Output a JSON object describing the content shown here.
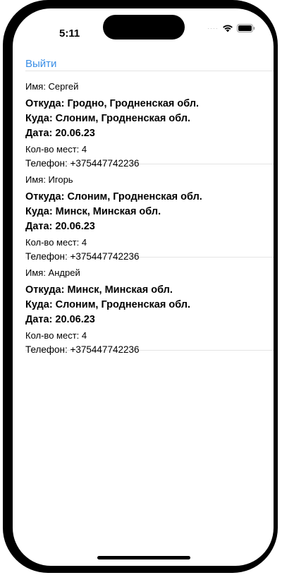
{
  "status": {
    "time": "5:11"
  },
  "nav": {
    "logout_label": "Выйти"
  },
  "rides": [
    {
      "name": "Имя: Сергей",
      "from": "Откуда: Гродно, Гродненская обл.",
      "to": "Куда: Слоним, Гродненская обл.",
      "date": "Дата: 20.06.23",
      "seats": "Кол-во мест: 4",
      "phone": "Телефон: +375447742236"
    },
    {
      "name": "Имя: Игорь",
      "from": "Откуда: Слоним, Гродненская обл.",
      "to": "Куда: Минск, Минская обл.",
      "date": "Дата: 20.06.23",
      "seats": "Кол-во мест: 4",
      "phone": "Телефон: +375447742236"
    },
    {
      "name": "Имя: Андрей",
      "from": "Откуда: Минск, Минская обл.",
      "to": "Куда: Слоним, Гродненская обл.",
      "date": "Дата: 20.06.23",
      "seats": "Кол-во мест: 4",
      "phone": "Телефон: +375447742236"
    }
  ]
}
